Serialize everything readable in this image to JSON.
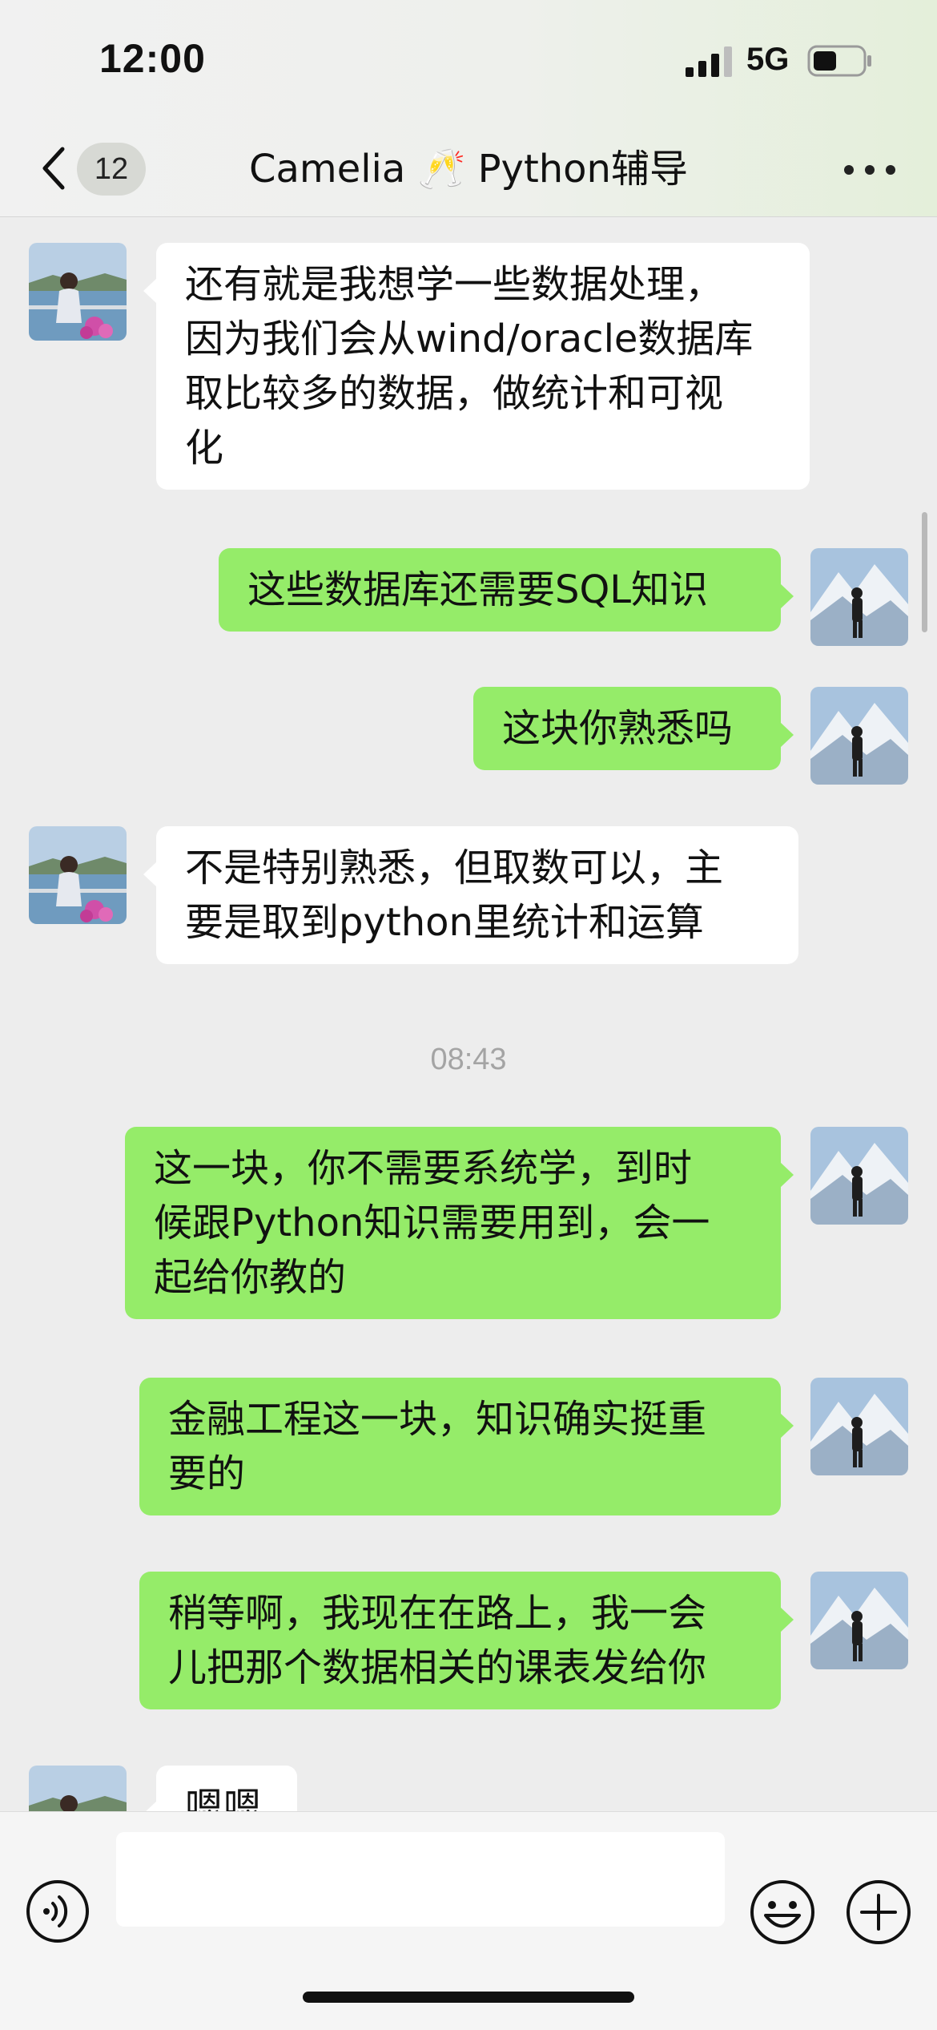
{
  "status_bar": {
    "time": "12:00",
    "network": "5G",
    "signal_icon": "cellular-signal-icon",
    "battery_icon": "battery-icon"
  },
  "header": {
    "back_icon": "chevron-left-icon",
    "unread_count": "12",
    "title": "Camelia 🥂 Python辅导",
    "more_icon": "more-dots-icon"
  },
  "messages": [
    {
      "sender": "peer",
      "lines": [
        "还有就是我想学一些数据处理，",
        "因为我们会从wind/oracle数据库",
        "取比较多的数据，做统计和可视",
        "化"
      ]
    },
    {
      "sender": "me",
      "lines": [
        "这些数据库还需要SQL知识"
      ]
    },
    {
      "sender": "me",
      "lines": [
        "这块你熟悉吗"
      ]
    },
    {
      "sender": "peer",
      "lines": [
        "不是特别熟悉，但取数可以，主",
        "要是取到python里统计和运算"
      ]
    },
    {
      "sender": "me",
      "lines": [
        "这一块，你不需要系统学，到时",
        "候跟Python知识需要用到，会一",
        "起给你教的"
      ]
    },
    {
      "sender": "me",
      "lines": [
        "金融工程这一块，知识确实挺重",
        "要的"
      ]
    },
    {
      "sender": "me",
      "lines": [
        "稍等啊，我现在在路上，我一会",
        "儿把那个数据相关的课表发给你"
      ]
    },
    {
      "sender": "peer",
      "lines": [
        "嗯嗯"
      ]
    }
  ],
  "timestamp": "08:43",
  "input_bar": {
    "message_value": "",
    "voice_icon": "voice-input-icon",
    "emoji_icon": "emoji-icon",
    "plus_icon": "plus-icon"
  },
  "colors": {
    "background": "#ededed",
    "my_bubble": "#95ec69",
    "peer_bubble": "#ffffff",
    "timestamp_text": "#a4a4a4"
  }
}
